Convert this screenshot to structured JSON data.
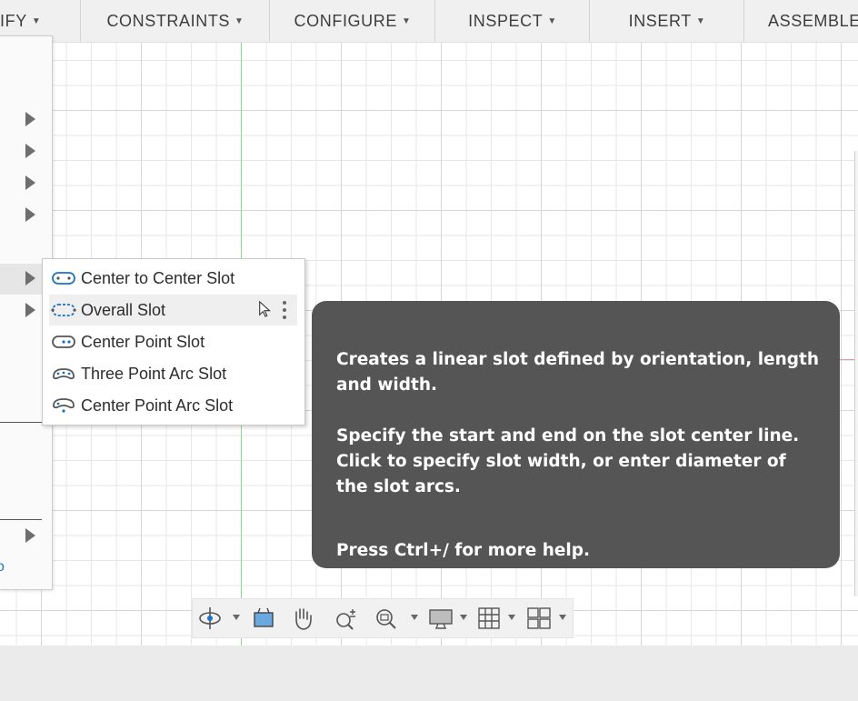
{
  "toolbar": {
    "items": [
      {
        "label": "IFY"
      },
      {
        "label": "CONSTRAINTS"
      },
      {
        "label": "CONFIGURE"
      },
      {
        "label": "INSPECT"
      },
      {
        "label": "INSERT"
      },
      {
        "label": "ASSEMBLE"
      }
    ]
  },
  "submenu": {
    "items": [
      {
        "label": "Center to Center Slot",
        "icon": "center-to-center-slot-icon"
      },
      {
        "label": "Overall Slot",
        "icon": "overall-slot-icon"
      },
      {
        "label": "Center Point Slot",
        "icon": "center-point-slot-icon"
      },
      {
        "label": "Three Point Arc Slot",
        "icon": "three-point-arc-slot-icon"
      },
      {
        "label": "Center Point Arc Slot",
        "icon": "center-point-arc-slot-icon"
      }
    ]
  },
  "tooltip": {
    "line1": "Creates a linear slot defined by orientation, length and width.",
    "line2": "Specify the start and end on the slot center line. Click to specify slot width, or enter diameter of the slot arcs.",
    "line3": "Press Ctrl+/ for more help."
  },
  "left_menu": {
    "glyph": "o"
  },
  "colors": {
    "accent": "#1a73c8",
    "tooltip_bg": "#555555",
    "axis_green": "#8fd98f",
    "axis_red": "#e89a9a"
  }
}
